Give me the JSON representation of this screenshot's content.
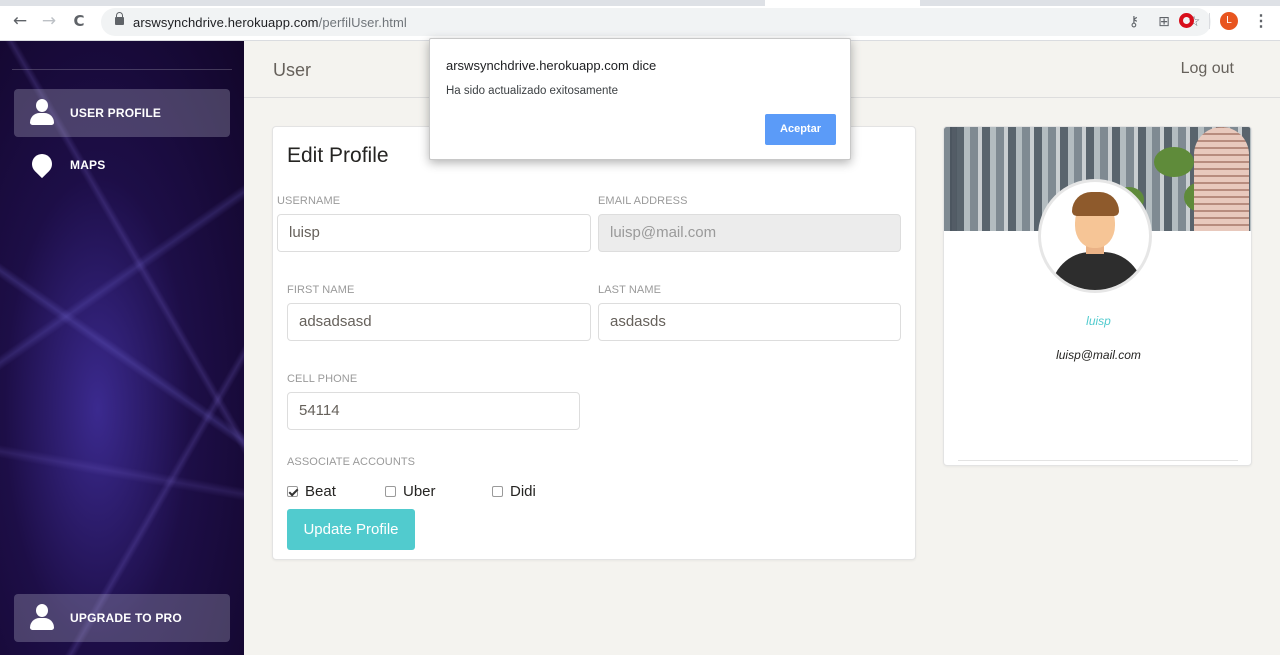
{
  "browser": {
    "url_domain": "arswsynchdrive.herokuapp.com",
    "url_path": "/perfilUser.html",
    "profile_initial": "L",
    "back_icon": "←",
    "forward_icon": "→",
    "reload_icon": "C",
    "key_icon": "⚷",
    "translate_icon": "⊞",
    "star_icon": "☆",
    "menu_icon": "⋮"
  },
  "sidebar": {
    "items": [
      {
        "label": "USER PROFILE",
        "icon": "user-icon",
        "active": true
      },
      {
        "label": "MAPS",
        "icon": "map-pin-icon",
        "active": false
      }
    ],
    "upgrade_label": "UPGRADE TO PRO"
  },
  "navbar": {
    "brand": "User",
    "logout": "Log out"
  },
  "edit_profile": {
    "title": "Edit Profile",
    "fields": {
      "username_label": "USERNAME",
      "username_value": "luisp",
      "email_label": "EMAIL ADDRESS",
      "email_value": "luisp@mail.com",
      "first_name_label": "FIRST NAME",
      "first_name_value": "adsadsasd",
      "last_name_label": "LAST NAME",
      "last_name_value": "asdasds",
      "cell_phone_label": "CELL PHONE",
      "cell_phone_value": "54114"
    },
    "accounts_label": "ASSOCIATE ACCOUNTS",
    "accounts": [
      {
        "label": "Beat",
        "checked": true
      },
      {
        "label": "Uber",
        "checked": false
      },
      {
        "label": "Didi",
        "checked": false
      }
    ],
    "submit_label": "Update Profile"
  },
  "profile_card": {
    "username": "luisp",
    "email": "luisp@mail.com"
  },
  "dialog": {
    "title": "arswsynchdrive.herokuapp.com dice",
    "message": "Ha sido actualizado exitosamente",
    "ok_label": "Aceptar"
  },
  "colors": {
    "accent": "#51cbce",
    "sidebar_bg": "#1a0b3a",
    "dialog_button": "#5b9bf8"
  }
}
